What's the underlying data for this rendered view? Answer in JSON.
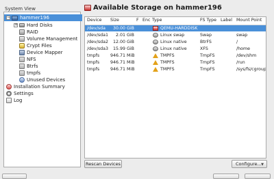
{
  "window": {
    "system_view_label": "System View",
    "title": "Available Storage on hammer196"
  },
  "tree": {
    "root": {
      "label": "hammer196",
      "expander": "−",
      "icon": "computer-icon"
    },
    "items": [
      {
        "label": "Hard Disks",
        "icon": "disk-icon",
        "expander": "+"
      },
      {
        "label": "RAID",
        "icon": "raid-icon"
      },
      {
        "label": "Volume Management",
        "icon": "volume-icon"
      },
      {
        "label": "Crypt Files",
        "icon": "crypt-icon"
      },
      {
        "label": "Device Mapper",
        "icon": "mapper-icon"
      },
      {
        "label": "NFS",
        "icon": "filesystem-icon"
      },
      {
        "label": "Btrfs",
        "icon": "filesystem-icon"
      },
      {
        "label": "tmpfs",
        "icon": "filesystem-icon"
      },
      {
        "label": "Unused Devices",
        "icon": "unused-icon"
      }
    ],
    "top_items": [
      {
        "label": "Installation Summary",
        "icon": "summary-icon"
      },
      {
        "label": "Settings",
        "icon": "settings-icon"
      },
      {
        "label": "Log",
        "icon": "log-icon"
      }
    ]
  },
  "table": {
    "columns": [
      "Device",
      "Size",
      "F",
      "Enc",
      "Type",
      "FS Type",
      "Label",
      "Mount Point"
    ],
    "rows": [
      {
        "device": "/dev/sda",
        "size": "30.00 GiB",
        "f": "",
        "enc": "",
        "type": "QEMU-HARDDISK",
        "type_icon": "harddisk-icon",
        "fs_type": "",
        "label": "",
        "mount": "",
        "selected": true
      },
      {
        "device": "/dev/sda1",
        "size": "2.01 GiB",
        "f": "",
        "enc": "",
        "type": "Linux swap",
        "type_icon": "swap-icon",
        "fs_type": "Swap",
        "label": "",
        "mount": "swap"
      },
      {
        "device": "/dev/sda2",
        "size": "12.00 GiB",
        "f": "",
        "enc": "",
        "type": "Linux native",
        "type_icon": "native-icon",
        "fs_type": "BtrFS",
        "label": "",
        "mount": "/"
      },
      {
        "device": "/dev/sda3",
        "size": "15.99 GiB",
        "f": "",
        "enc": "",
        "type": "Linux native",
        "type_icon": "native-icon",
        "fs_type": "XFS",
        "label": "",
        "mount": "/home"
      },
      {
        "device": "tmpfs",
        "size": "946.71 MiB",
        "f": "",
        "enc": "",
        "type": "TMPFS",
        "type_icon": "tmpfs-icon",
        "fs_type": "TmpFS",
        "label": "",
        "mount": "/dev/shm"
      },
      {
        "device": "tmpfs",
        "size": "946.71 MiB",
        "f": "",
        "enc": "",
        "type": "TMPFS",
        "type_icon": "tmpfs-icon",
        "fs_type": "TmpFS",
        "label": "",
        "mount": "/run"
      },
      {
        "device": "tmpfs",
        "size": "946.71 MiB",
        "f": "",
        "enc": "",
        "type": "TMPFS",
        "type_icon": "tmpfs-icon",
        "fs_type": "TmpFS",
        "label": "",
        "mount": "/sys/fs/cgroup"
      }
    ]
  },
  "buttons": {
    "rescan": "Rescan Devices",
    "configure": "Configure...",
    "configure_chevron": "▼"
  },
  "colors": {
    "selection": "#4a90d9"
  }
}
